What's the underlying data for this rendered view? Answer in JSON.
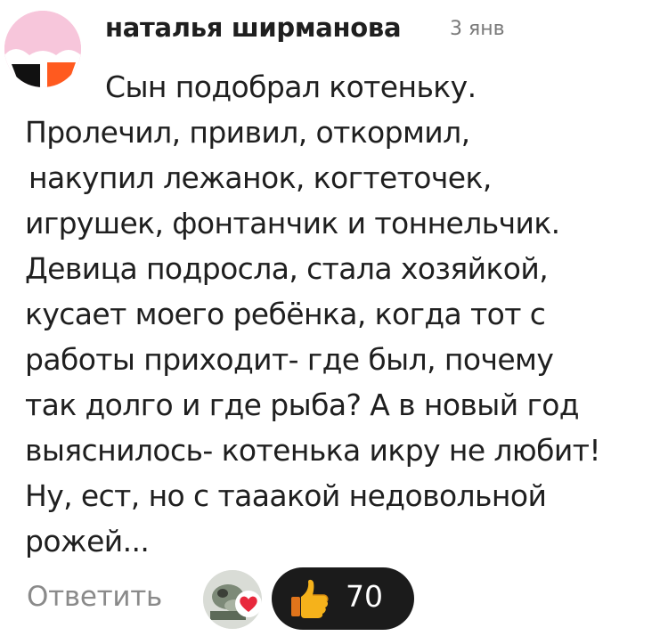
{
  "comment": {
    "author": "наталья ширманова",
    "date": "3 янв",
    "lines": [
      "Сын подобрал котеньку.",
      "Пролечил, привил, откормил,",
      "накупил лежанок, когтеточек,",
      "игрушек, фонтанчик и тоннельчик.",
      "Девица подросла, стала хозяйкой,",
      "кусает моего  ребёнка, когда тот с",
      "работы приходит- где был, почему",
      "так долго и где рыба? А в новый год",
      "выяснилось- котенька икру не любит!",
      "Ну, ест, но с тааакой недовольной",
      "рожей..."
    ]
  },
  "footer": {
    "reply_label": "Ответить",
    "reaction_count": "70"
  },
  "icons": {
    "reaction": "thumbs-up-icon",
    "reactor_badge": "heart-icon"
  },
  "colors": {
    "reaction_pill": "#1b1b1b",
    "heart": "#e8283c",
    "thumb": "#f5b21b"
  }
}
